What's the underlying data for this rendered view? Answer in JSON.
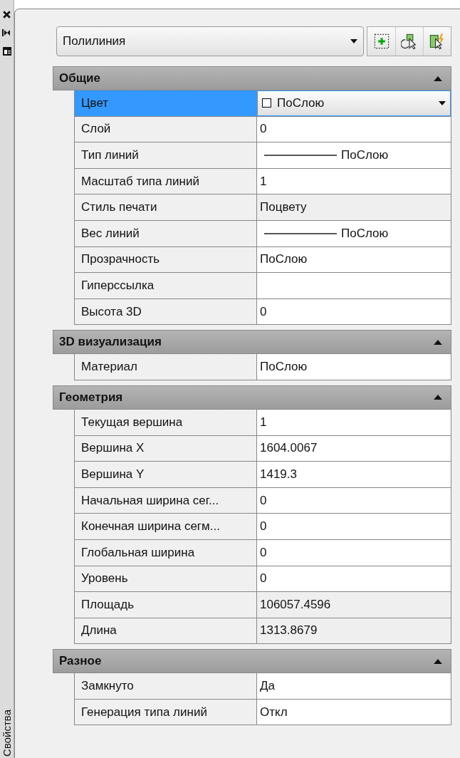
{
  "side_strip": {
    "label": "Свойства"
  },
  "selector": {
    "value": "Полилиния"
  },
  "sections": [
    {
      "title": "Общие",
      "expanded": true,
      "rows": [
        {
          "name": "Цвет",
          "value": "ПоСлою",
          "kind": "color",
          "selected": true,
          "read_only": false
        },
        {
          "name": "Слой",
          "value": "0",
          "kind": "text",
          "selected": false,
          "read_only": false
        },
        {
          "name": "Тип линий",
          "value": "ПоСлою",
          "kind": "linetype",
          "selected": false,
          "read_only": false
        },
        {
          "name": "Масштаб типа линий",
          "value": "1",
          "kind": "text",
          "selected": false,
          "read_only": false
        },
        {
          "name": "Стиль печати",
          "value": "Поцвету",
          "kind": "text",
          "selected": false,
          "read_only": true
        },
        {
          "name": "Вес линий",
          "value": "ПоСлою",
          "kind": "linetype",
          "selected": false,
          "read_only": false
        },
        {
          "name": "Прозрачность",
          "value": "ПоСлою",
          "kind": "text",
          "selected": false,
          "read_only": false
        },
        {
          "name": "Гиперссылка",
          "kind": "text",
          "selected": false,
          "read_only": false
        },
        {
          "name": "Высота 3D",
          "value": "0",
          "kind": "text",
          "selected": false,
          "read_only": false
        }
      ]
    },
    {
      "title": "3D визуализация",
      "expanded": true,
      "rows": [
        {
          "name": "Материал",
          "value": "ПоСлою",
          "kind": "text",
          "selected": false,
          "read_only": false
        }
      ]
    },
    {
      "title": "Геометрия",
      "expanded": true,
      "rows": [
        {
          "name": "Текущая вершина",
          "value": "1",
          "kind": "text",
          "selected": false,
          "read_only": false
        },
        {
          "name": "Вершина X",
          "value": "1604.0067",
          "kind": "text",
          "selected": false,
          "read_only": false
        },
        {
          "name": "Вершина Y",
          "value": "1419.3",
          "kind": "text",
          "selected": false,
          "read_only": false
        },
        {
          "name": "Начальная ширина сег...",
          "value": "0",
          "kind": "text",
          "selected": false,
          "read_only": false
        },
        {
          "name": "Конечная ширина сегм...",
          "value": "0",
          "kind": "text",
          "selected": false,
          "read_only": false
        },
        {
          "name": "Глобальная ширина",
          "value": "0",
          "kind": "text",
          "selected": false,
          "read_only": false
        },
        {
          "name": "Уровень",
          "value": "0",
          "kind": "text",
          "selected": false,
          "read_only": false
        },
        {
          "name": "Площадь",
          "value": "106057.4596",
          "kind": "text",
          "selected": false,
          "read_only": true
        },
        {
          "name": "Длина",
          "value": "1313.8679",
          "kind": "text",
          "selected": false,
          "read_only": true
        }
      ]
    },
    {
      "title": "Разное",
      "expanded": true,
      "rows": [
        {
          "name": "Замкнуто",
          "value": "Да",
          "kind": "text",
          "selected": false,
          "read_only": false
        },
        {
          "name": "Генерация типа линий",
          "value": "Откл",
          "kind": "text",
          "selected": false,
          "read_only": false
        }
      ]
    }
  ]
}
